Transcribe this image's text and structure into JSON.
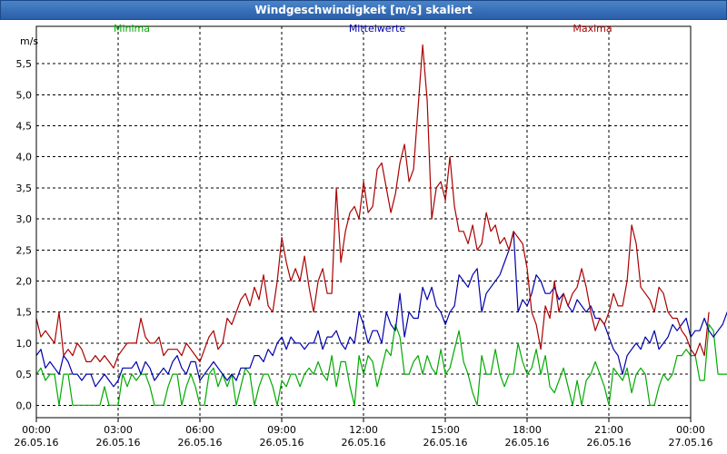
{
  "window": {
    "title": "Windgeschwindigkeit [m/s] skaliert"
  },
  "chart_data": {
    "type": "line",
    "title": "Windgeschwindigkeit [m/s] skaliert",
    "ylabel": "m/s",
    "ylim": [
      -0.2,
      6.1
    ],
    "xlim": [
      0,
      24
    ],
    "grid": true,
    "legend_placement": "top",
    "yticks": [
      "0,0",
      "0,5",
      "1,0",
      "1,5",
      "2,0",
      "2,5",
      "3,0",
      "3,5",
      "4,0",
      "4,5",
      "5,0",
      "5,5"
    ],
    "ytick_values": [
      0,
      0.5,
      1,
      1.5,
      2,
      2.5,
      3,
      3.5,
      4,
      4.5,
      5,
      5.5
    ],
    "xtick_values": [
      0,
      3,
      6,
      9,
      12,
      15,
      18,
      21,
      24
    ],
    "xticks": [
      [
        "00:00",
        "26.05.16"
      ],
      [
        "03:00",
        "26.05.16"
      ],
      [
        "06:00",
        "26.05.16"
      ],
      [
        "09:00",
        "26.05.16"
      ],
      [
        "12:00",
        "26.05.16"
      ],
      [
        "15:00",
        "26.05.16"
      ],
      [
        "18:00",
        "26.05.16"
      ],
      [
        "21:00",
        "26.05.16"
      ],
      [
        "00:00",
        "27.05.16"
      ]
    ],
    "step_hours": 0.1667,
    "series": [
      {
        "name": "Minima",
        "color": "#00aa00",
        "values": [
          0.5,
          0.6,
          0.4,
          0.5,
          0.5,
          0.0,
          0.5,
          0.5,
          0.0,
          0.0,
          0.0,
          0.0,
          0.0,
          0.0,
          0.0,
          0.3,
          0.0,
          0.0,
          0.0,
          0.5,
          0.3,
          0.5,
          0.4,
          0.5,
          0.5,
          0.3,
          0.0,
          0.0,
          0.0,
          0.3,
          0.5,
          0.5,
          0.0,
          0.3,
          0.5,
          0.3,
          0.0,
          0.0,
          0.5,
          0.6,
          0.3,
          0.5,
          0.3,
          0.5,
          0.0,
          0.3,
          0.6,
          0.5,
          0.0,
          0.3,
          0.5,
          0.5,
          0.3,
          0.0,
          0.4,
          0.3,
          0.5,
          0.5,
          0.3,
          0.5,
          0.6,
          0.5,
          0.7,
          0.5,
          0.4,
          0.8,
          0.3,
          0.7,
          0.7,
          0.3,
          0.0,
          0.8,
          0.5,
          0.8,
          0.7,
          0.3,
          0.6,
          0.9,
          0.8,
          1.3,
          1.1,
          0.5,
          0.5,
          0.7,
          0.8,
          0.5,
          0.8,
          0.6,
          0.5,
          0.9,
          0.5,
          0.6,
          0.9,
          1.2,
          0.7,
          0.5,
          0.2,
          0.0,
          0.8,
          0.5,
          0.5,
          0.9,
          0.5,
          0.3,
          0.5,
          0.5,
          1.0,
          0.7,
          0.5,
          0.6,
          0.9,
          0.5,
          0.8,
          0.3,
          0.2,
          0.4,
          0.6,
          0.3,
          0.0,
          0.4,
          0.0,
          0.4,
          0.5,
          0.7,
          0.5,
          0.3,
          0.0,
          0.6,
          0.5,
          0.4,
          0.6,
          0.2,
          0.5,
          0.6,
          0.5,
          0.0,
          0.0,
          0.3,
          0.5,
          0.4,
          0.5,
          0.8,
          0.8,
          0.9,
          0.8,
          0.8,
          0.4,
          0.4,
          1.3,
          1.2,
          0.5,
          0.5,
          0.5,
          0.5,
          0.5,
          0.5,
          0.5,
          0.5,
          0.5,
          0.3
        ]
      },
      {
        "name": "Mittelwerte",
        "color": "#0000aa",
        "values": [
          0.8,
          0.9,
          0.6,
          0.7,
          0.6,
          0.5,
          0.8,
          0.7,
          0.5,
          0.5,
          0.4,
          0.5,
          0.5,
          0.3,
          0.4,
          0.5,
          0.4,
          0.3,
          0.4,
          0.6,
          0.6,
          0.6,
          0.7,
          0.5,
          0.7,
          0.6,
          0.4,
          0.5,
          0.6,
          0.5,
          0.7,
          0.8,
          0.6,
          0.5,
          0.7,
          0.7,
          0.4,
          0.5,
          0.6,
          0.7,
          0.6,
          0.5,
          0.4,
          0.5,
          0.4,
          0.6,
          0.6,
          0.6,
          0.8,
          0.8,
          0.7,
          0.9,
          0.8,
          1.0,
          1.1,
          0.9,
          1.1,
          1.0,
          1.0,
          0.9,
          1.0,
          1.0,
          1.2,
          0.9,
          1.1,
          1.1,
          1.2,
          1.0,
          0.9,
          1.1,
          1.0,
          1.5,
          1.3,
          1.0,
          1.2,
          1.2,
          1.0,
          1.5,
          1.3,
          1.2,
          1.8,
          1.1,
          1.5,
          1.4,
          1.4,
          1.9,
          1.7,
          1.9,
          1.6,
          1.5,
          1.3,
          1.5,
          1.6,
          2.1,
          2.0,
          1.9,
          2.1,
          2.2,
          1.5,
          1.8,
          1.9,
          2.0,
          2.1,
          2.3,
          2.5,
          2.8,
          1.5,
          1.7,
          1.6,
          1.8,
          2.1,
          2.0,
          1.8,
          1.8,
          1.9,
          1.7,
          1.8,
          1.6,
          1.5,
          1.7,
          1.6,
          1.5,
          1.6,
          1.4,
          1.4,
          1.3,
          1.1,
          0.9,
          0.8,
          0.5,
          0.8,
          0.9,
          1.0,
          0.9,
          1.1,
          1.0,
          1.2,
          0.9,
          1.0,
          1.1,
          1.3,
          1.2,
          1.3,
          1.4,
          1.1,
          1.2,
          1.2,
          1.4,
          1.2,
          1.1,
          1.2,
          1.3,
          1.5,
          1.6,
          1.5,
          1.2,
          1.1,
          0.9,
          1.1,
          1.0,
          0.8,
          0.7,
          0.6,
          0.7,
          0.8
        ]
      },
      {
        "name": "Maxima",
        "color": "#aa0000",
        "values": [
          1.4,
          1.1,
          1.2,
          1.1,
          1.0,
          1.5,
          0.8,
          0.9,
          0.8,
          1.0,
          0.9,
          0.7,
          0.7,
          0.8,
          0.7,
          0.8,
          0.7,
          0.6,
          0.8,
          0.9,
          1.0,
          1.0,
          1.0,
          1.4,
          1.1,
          1.0,
          1.0,
          1.1,
          0.8,
          0.9,
          0.9,
          0.9,
          0.8,
          1.0,
          0.9,
          0.8,
          0.7,
          0.9,
          1.1,
          1.2,
          0.9,
          1.0,
          1.4,
          1.3,
          1.5,
          1.7,
          1.8,
          1.6,
          1.9,
          1.7,
          2.1,
          1.6,
          1.5,
          2.0,
          2.7,
          2.3,
          2.0,
          2.2,
          2.0,
          2.4,
          1.9,
          1.5,
          2.0,
          2.2,
          1.8,
          1.8,
          3.5,
          2.3,
          2.8,
          3.1,
          3.2,
          3.0,
          3.6,
          3.1,
          3.2,
          3.8,
          3.9,
          3.5,
          3.1,
          3.4,
          3.9,
          4.2,
          3.6,
          3.8,
          4.8,
          5.8,
          4.9,
          3.0,
          3.5,
          3.6,
          3.3,
          4.0,
          3.2,
          2.8,
          2.8,
          2.6,
          2.9,
          2.5,
          2.6,
          3.1,
          2.8,
          2.9,
          2.6,
          2.7,
          2.5,
          2.8,
          2.7,
          2.6,
          2.2,
          1.5,
          1.3,
          0.9,
          1.6,
          1.4,
          2.0,
          1.5,
          1.8,
          1.6,
          1.8,
          1.9,
          2.2,
          1.9,
          1.5,
          1.2,
          1.4,
          1.3,
          1.5,
          1.8,
          1.6,
          1.6,
          2.0,
          2.9,
          2.6,
          1.9,
          1.8,
          1.7,
          1.5,
          1.9,
          1.8,
          1.5,
          1.4,
          1.4,
          1.2,
          1.1,
          0.9,
          0.8,
          1.0,
          0.8,
          1.5
        ]
      }
    ]
  }
}
